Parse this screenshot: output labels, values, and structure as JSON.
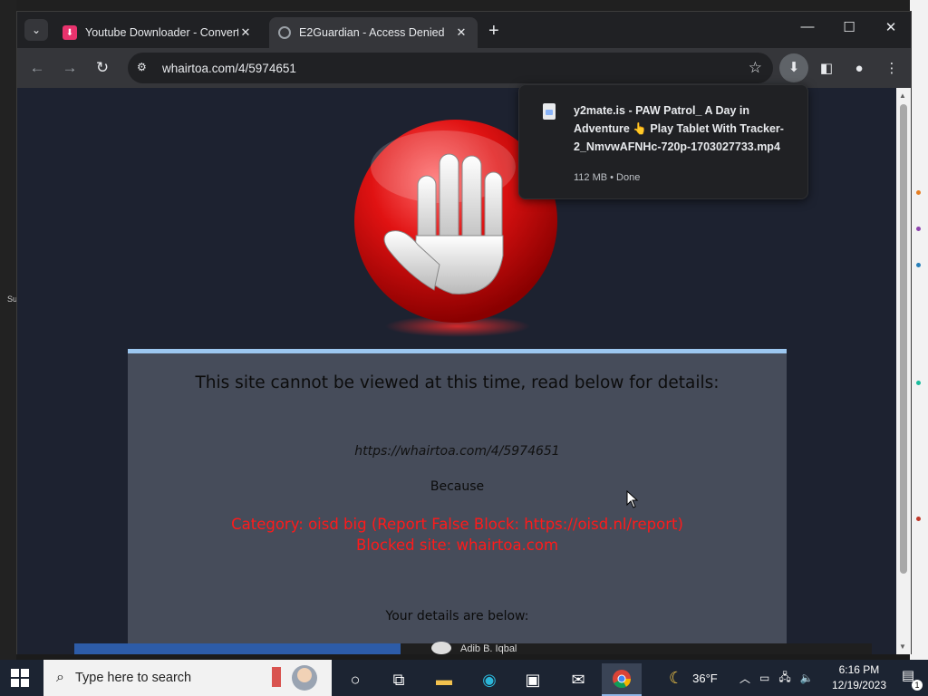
{
  "browser": {
    "tabs": [
      {
        "title": "Youtube Downloader - Convert",
        "favicon": "download-favicon-icon",
        "active": false
      },
      {
        "title": "E2Guardian - Access Denied",
        "favicon": "globe-icon",
        "active": true
      }
    ],
    "new_tab_label": "+",
    "address": "whairtoa.com/4/5974651"
  },
  "download": {
    "filename": "y2mate.is - PAW Patrol_ A Day in Adventure 👆 Play Tablet With Tracker-2_NmvwAFNHc-720p-1703027733.mp4",
    "status": "112 MB • Done"
  },
  "blockpage": {
    "heading": "This site cannot be viewed at this time, read below for details:",
    "url": "https://whairtoa.com/4/5974651",
    "because": "Because",
    "reason_line1": "Category: oisd big (Report False Block: https://oisd.nl/report)",
    "reason_line2": "Blocked site: whairtoa.com",
    "details": "Your details are below:",
    "accent_color": "#ff1a1a"
  },
  "background_video": {
    "author": "Adib B. Iqbal"
  },
  "taskbar": {
    "search_placeholder": "Type here to search",
    "weather": "36°F",
    "time": "6:16 PM",
    "date": "12/19/2023",
    "notification_count": "1"
  },
  "desktop": {
    "left_sliver_text": "Su"
  }
}
